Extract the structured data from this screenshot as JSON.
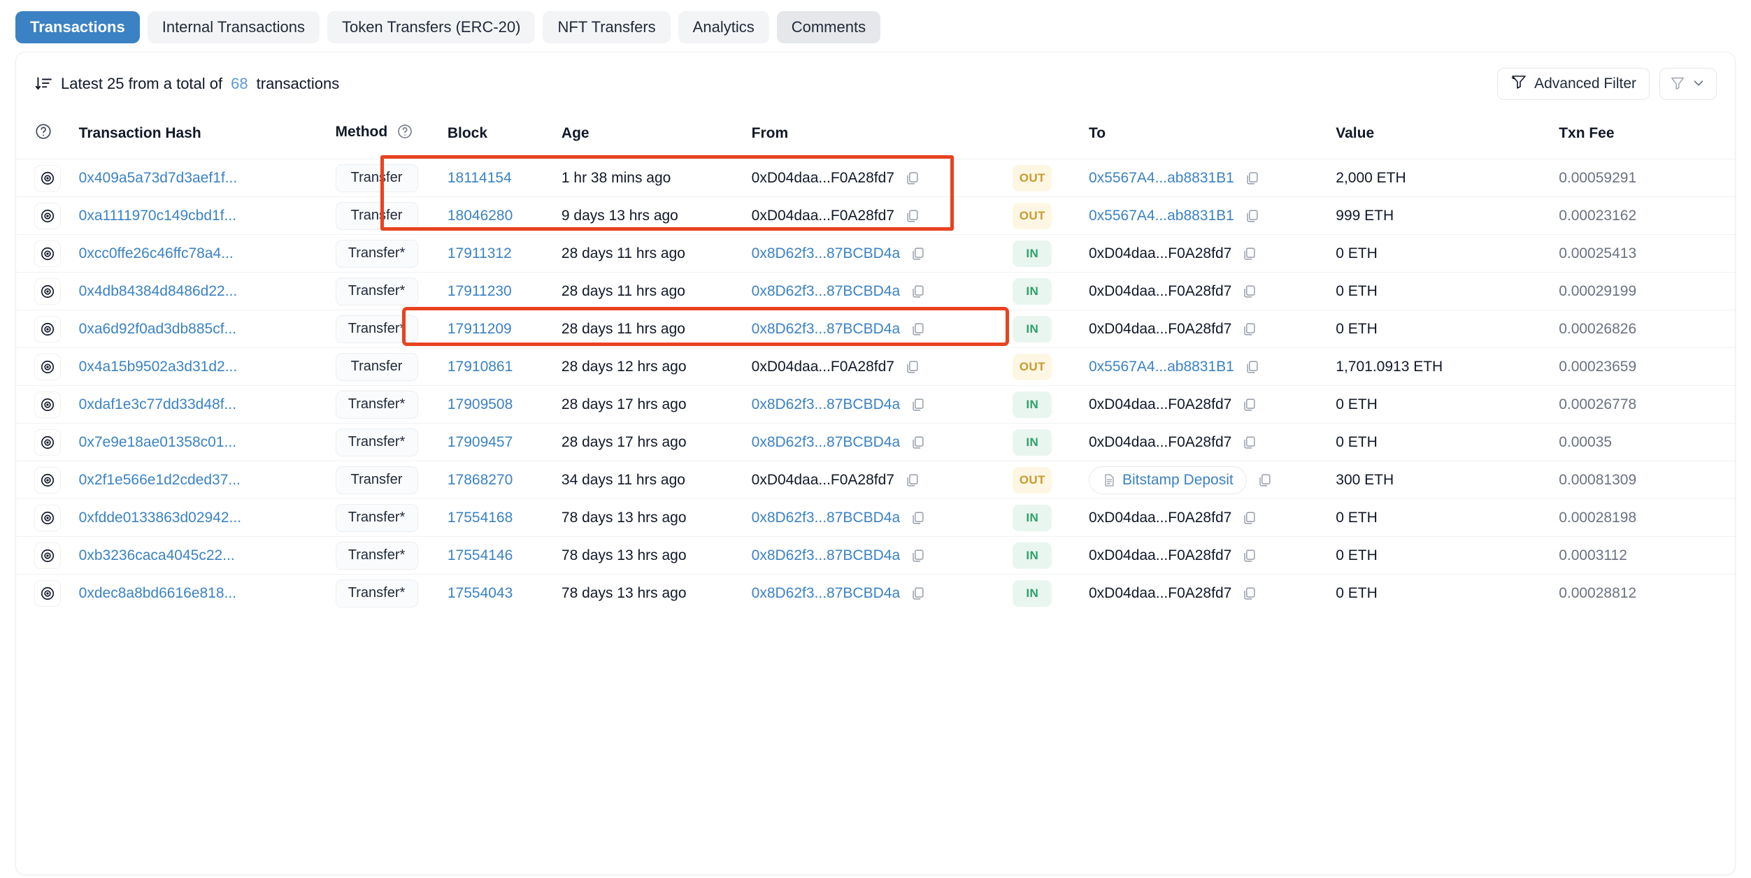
{
  "tabs": [
    {
      "label": "Transactions",
      "state": "active"
    },
    {
      "label": "Internal Transactions",
      "state": "normal"
    },
    {
      "label": "Token Transfers (ERC-20)",
      "state": "normal"
    },
    {
      "label": "NFT Transfers",
      "state": "normal"
    },
    {
      "label": "Analytics",
      "state": "normal"
    },
    {
      "label": "Comments",
      "state": "shaded"
    }
  ],
  "toolbar": {
    "sort_icon": "sort-descending-icon",
    "summary_prefix": "Latest 25 from a total of",
    "summary_count": "68",
    "summary_suffix": "transactions",
    "advanced_filter_label": "Advanced Filter",
    "filter_icon": "funnel-icon",
    "chevron_icon": "chevron-down-icon"
  },
  "columns": {
    "info": "?",
    "hash": "Transaction Hash",
    "method": "Method",
    "method_info": "?",
    "block": "Block",
    "age": "Age",
    "from": "From",
    "to": "To",
    "value": "Value",
    "fee": "Txn Fee"
  },
  "colors": {
    "accent_blue": "#3b82c4",
    "tab_active_bg": "#3b82c4",
    "badge_out_bg": "#fdf6e3",
    "badge_out_text": "#c99a2e",
    "badge_in_bg": "#e9f6ef",
    "badge_in_text": "#2ea06b",
    "annotation_red": "#e8431f"
  },
  "rows": [
    {
      "hash": "0x409a5a73d7d3aef1f...",
      "method": "Transfer",
      "block": "18114154",
      "age": "1 hr 38 mins ago",
      "from": "0xD04daa...F0A28fd7",
      "from_link": false,
      "direction": "OUT",
      "to": "0x5567A4...ab8831B1",
      "to_link": true,
      "to_tag": false,
      "value": "2,000 ETH",
      "fee": "0.00059291"
    },
    {
      "hash": "0xa1111970c149cbd1f...",
      "method": "Transfer",
      "block": "18046280",
      "age": "9 days 13 hrs ago",
      "from": "0xD04daa...F0A28fd7",
      "from_link": false,
      "direction": "OUT",
      "to": "0x5567A4...ab8831B1",
      "to_link": true,
      "to_tag": false,
      "value": "999 ETH",
      "fee": "0.00023162"
    },
    {
      "hash": "0xcc0ffe26c46ffc78a4...",
      "method": "Transfer*",
      "block": "17911312",
      "age": "28 days 11 hrs ago",
      "from": "0x8D62f3...87BCBD4a",
      "from_link": true,
      "direction": "IN",
      "to": "0xD04daa...F0A28fd7",
      "to_link": false,
      "to_tag": false,
      "value": "0 ETH",
      "fee": "0.00025413"
    },
    {
      "hash": "0x4db84384d8486d22...",
      "method": "Transfer*",
      "block": "17911230",
      "age": "28 days 11 hrs ago",
      "from": "0x8D62f3...87BCBD4a",
      "from_link": true,
      "direction": "IN",
      "to": "0xD04daa...F0A28fd7",
      "to_link": false,
      "to_tag": false,
      "value": "0 ETH",
      "fee": "0.00029199"
    },
    {
      "hash": "0xa6d92f0ad3db885cf...",
      "method": "Transfer*",
      "block": "17911209",
      "age": "28 days 11 hrs ago",
      "from": "0x8D62f3...87BCBD4a",
      "from_link": true,
      "direction": "IN",
      "to": "0xD04daa...F0A28fd7",
      "to_link": false,
      "to_tag": false,
      "value": "0 ETH",
      "fee": "0.00026826"
    },
    {
      "hash": "0x4a15b9502a3d31d2...",
      "method": "Transfer",
      "block": "17910861",
      "age": "28 days 12 hrs ago",
      "from": "0xD04daa...F0A28fd7",
      "from_link": false,
      "direction": "OUT",
      "to": "0x5567A4...ab8831B1",
      "to_link": true,
      "to_tag": false,
      "value": "1,701.0913 ETH",
      "fee": "0.00023659"
    },
    {
      "hash": "0xdaf1e3c77dd33d48f...",
      "method": "Transfer*",
      "block": "17909508",
      "age": "28 days 17 hrs ago",
      "from": "0x8D62f3...87BCBD4a",
      "from_link": true,
      "direction": "IN",
      "to": "0xD04daa...F0A28fd7",
      "to_link": false,
      "to_tag": false,
      "value": "0 ETH",
      "fee": "0.00026778"
    },
    {
      "hash": "0x7e9e18ae01358c01...",
      "method": "Transfer*",
      "block": "17909457",
      "age": "28 days 17 hrs ago",
      "from": "0x8D62f3...87BCBD4a",
      "from_link": true,
      "direction": "IN",
      "to": "0xD04daa...F0A28fd7",
      "to_link": false,
      "to_tag": false,
      "value": "0 ETH",
      "fee": "0.00035"
    },
    {
      "hash": "0x2f1e566e1d2cded37...",
      "method": "Transfer",
      "block": "17868270",
      "age": "34 days 11 hrs ago",
      "from": "0xD04daa...F0A28fd7",
      "from_link": false,
      "direction": "OUT",
      "to": "Bitstamp Deposit",
      "to_link": true,
      "to_tag": true,
      "value": "300 ETH",
      "fee": "0.00081309"
    },
    {
      "hash": "0xfdde0133863d02942...",
      "method": "Transfer*",
      "block": "17554168",
      "age": "78 days 13 hrs ago",
      "from": "0x8D62f3...87BCBD4a",
      "from_link": true,
      "direction": "IN",
      "to": "0xD04daa...F0A28fd7",
      "to_link": false,
      "to_tag": false,
      "value": "0 ETH",
      "fee": "0.00028198"
    },
    {
      "hash": "0xb3236caca4045c22...",
      "method": "Transfer*",
      "block": "17554146",
      "age": "78 days 13 hrs ago",
      "from": "0x8D62f3...87BCBD4a",
      "from_link": true,
      "direction": "IN",
      "to": "0xD04daa...F0A28fd7",
      "to_link": false,
      "to_tag": false,
      "value": "0 ETH",
      "fee": "0.0003112"
    },
    {
      "hash": "0xdec8a8bd6616e818...",
      "method": "Transfer*",
      "block": "17554043",
      "age": "78 days 13 hrs ago",
      "from": "0x8D62f3...87BCBD4a",
      "from_link": true,
      "direction": "IN",
      "to": "0xD04daa...F0A28fd7",
      "to_link": false,
      "to_tag": false,
      "value": "0 ETH",
      "fee": "0.00028812"
    }
  ],
  "annotations": [
    {
      "name": "highlight-box-rows-1-2",
      "shape": "rectangle",
      "color": "#e8431f"
    },
    {
      "name": "highlight-box-row-6",
      "shape": "rounded-rectangle",
      "color": "#e8431f"
    }
  ]
}
